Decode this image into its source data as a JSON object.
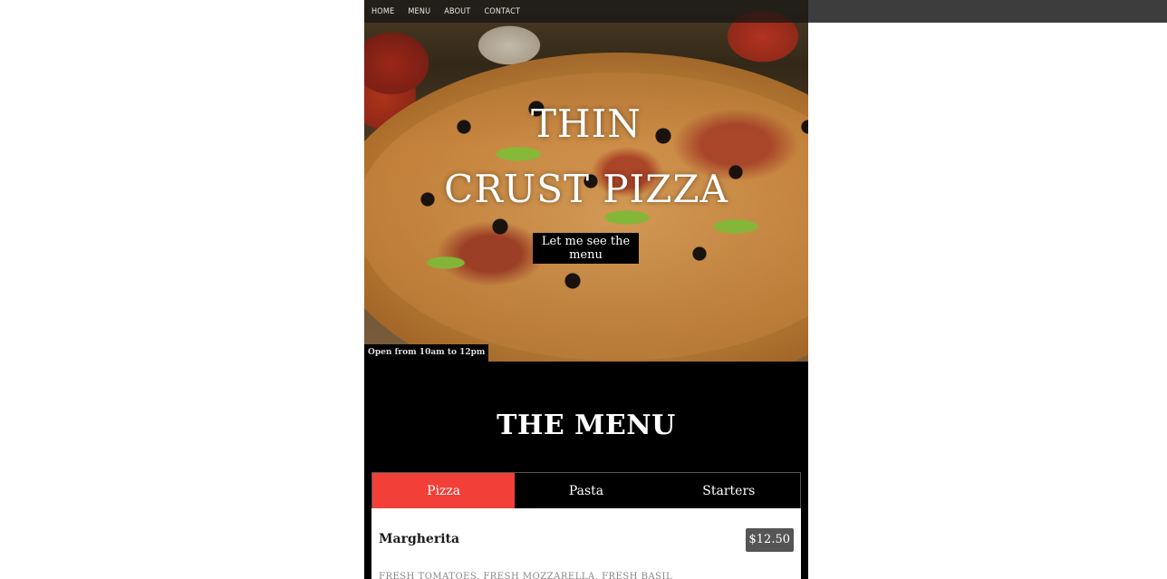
{
  "nav": {
    "items": [
      {
        "label": "HOME"
      },
      {
        "label": "MENU"
      },
      {
        "label": "ABOUT"
      },
      {
        "label": "CONTACT"
      }
    ]
  },
  "hero": {
    "title_line1": "THIN",
    "title_line2": "CRUST PIZZA",
    "cta_label": "Let me see the menu",
    "open_hours": "Open from 10am to 12pm"
  },
  "menu": {
    "title": "THE MENU",
    "tabs": [
      {
        "label": "Pizza",
        "active": true
      },
      {
        "label": "Pasta",
        "active": false
      },
      {
        "label": "Starters",
        "active": false
      }
    ],
    "items": [
      {
        "name": "Margherita",
        "price": "$12.50",
        "description": "Fresh tomatoes, fresh mozzarella, fresh basil"
      }
    ]
  },
  "colors": {
    "accent": "#f23f37",
    "nav_bar": "#3d3d3d",
    "price_badge": "#555555"
  }
}
